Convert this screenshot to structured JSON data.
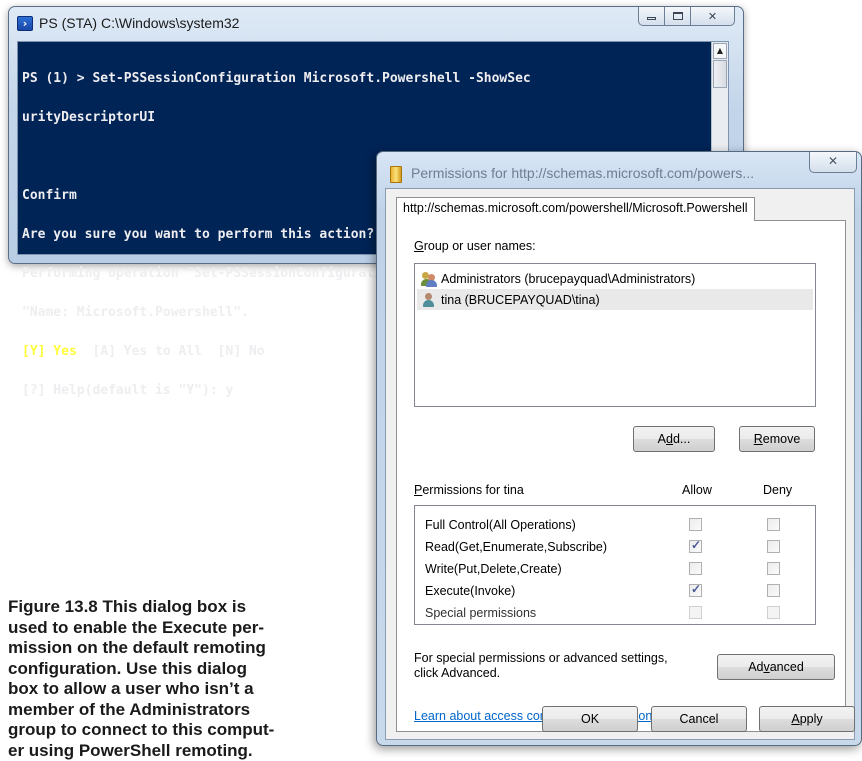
{
  "ps_window": {
    "title": "PS (STA) C:\\Windows\\system32",
    "console_lines": [
      {
        "text": "PS (1) > Set-PSSessionConfiguration Microsoft.Powershell -ShowSec",
        "color": "#eeedf0"
      },
      {
        "text": "urityDescriptorUI",
        "color": "#eeedf0"
      },
      {
        "text": "",
        "color": "#eeedf0"
      },
      {
        "text": "Confirm",
        "color": "#eeedf0"
      },
      {
        "text": "Are you sure you want to perform this action?",
        "color": "#eeedf0"
      },
      {
        "text": "Performing operation \"Set-PSSessionConfiguration\" on Target",
        "color": "#eeedf0"
      },
      {
        "text": "\"Name: Microsoft.Powershell\".",
        "color": "#eeedf0"
      },
      {
        "text": "[Y] Yes  [A] Yes to All  [N] No",
        "color": "#ffff3c",
        "partial": {
          "yellow": "[Y] Yes",
          "rest": "  [A] Yes to All  [N] No"
        }
      },
      {
        "text": "[?] Help(default is \"Y\"): y",
        "color": "#eeedf0"
      }
    ],
    "icons": {
      "app": "powershell-icon",
      "minimize": "minimize-icon",
      "maximize": "maximize-icon",
      "close": "close-icon"
    }
  },
  "caption": "Figure 13.8 This dialog box is used to enable the Execute permission on the default remoting configuration. Use this dialog box to allow a user who isn’t a member of the Administrators group to connect to this computer using PowerShell remoting.",
  "caption_lines": [
    "Figure 13.8    This dialog box is",
    "used to enable the Execute per-",
    "mission on the default remoting",
    "configuration. Use this dialog",
    "box to allow a user who isn’t a",
    "member of the Administrators",
    "group to connect to this comput-",
    "er using PowerShell remoting."
  ],
  "dialog": {
    "title": "Permissions for http://schemas.microsoft.com/powers...",
    "tab_label": "http://schemas.microsoft.com/powershell/Microsoft.Powershell",
    "group_label_pre": "",
    "group_label_ul": "G",
    "group_label_rest": "roup or user names:",
    "users": [
      {
        "name": "Administrators (brucepayquad\\Administrators)",
        "icon": "group-users-icon",
        "selected": false
      },
      {
        "name": "tina (BRUCEPAYQUAD\\tina)",
        "icon": "user-icon",
        "selected": true
      }
    ],
    "add_button": {
      "pre": "A",
      "ul": "d",
      "rest": "d..."
    },
    "remove_button": {
      "pre": "",
      "ul": "R",
      "rest": "emove"
    },
    "permissions_label": {
      "pre": "",
      "ul": "P",
      "rest": "ermissions for tina"
    },
    "allow_header": "Allow",
    "deny_header": "Deny",
    "permissions": [
      {
        "name": "Full Control(All Operations)",
        "allow": false,
        "deny": false,
        "disabled": false
      },
      {
        "name": "Read(Get,Enumerate,Subscribe)",
        "allow": true,
        "deny": false,
        "disabled": false
      },
      {
        "name": "Write(Put,Delete,Create)",
        "allow": false,
        "deny": false,
        "disabled": false
      },
      {
        "name": "Execute(Invoke)",
        "allow": true,
        "deny": false,
        "disabled": false
      },
      {
        "name": "Special permissions",
        "allow": false,
        "deny": false,
        "disabled": true
      }
    ],
    "advanced_text_line1": "For special permissions or advanced settings,",
    "advanced_text_line2": "click Advanced.",
    "advanced_button": {
      "pre": "Ad",
      "ul": "v",
      "rest": "anced"
    },
    "link": "Learn about access control and permissions",
    "ok_button": "OK",
    "cancel_button": "Cancel",
    "apply_button": {
      "pre": "",
      "ul": "A",
      "rest": "pply"
    },
    "icons": {
      "title": "folder-icon",
      "close": "close-icon"
    }
  }
}
